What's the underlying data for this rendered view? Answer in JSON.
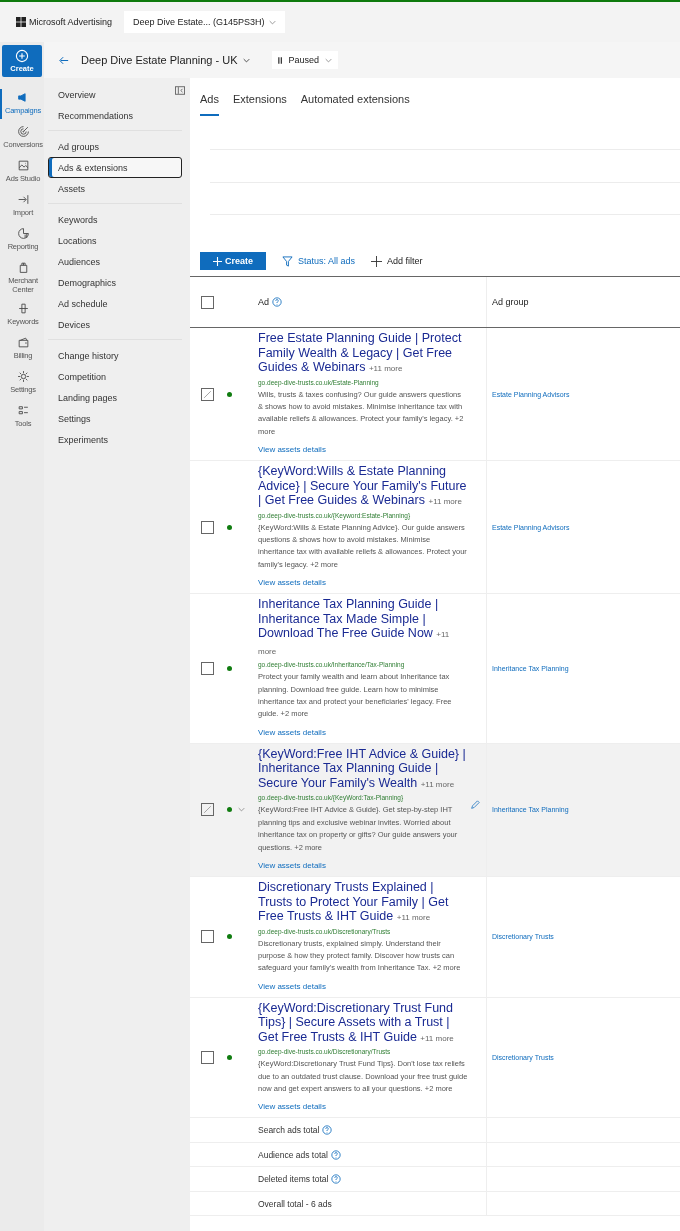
{
  "app": {
    "brand": "Microsoft Advertising",
    "account": "Deep Dive Estate... (G145PS3H)"
  },
  "rail": {
    "create": "Create",
    "items": [
      {
        "label": "Campaigns",
        "selected": true
      },
      {
        "label": "Conversions",
        "selected": false
      },
      {
        "label": "Ads Studio",
        "selected": false
      },
      {
        "label": "Import",
        "selected": false
      },
      {
        "label": "Reporting",
        "selected": false
      },
      {
        "label": "Merchant Center",
        "selected": false
      },
      {
        "label": "Keywords",
        "selected": false
      },
      {
        "label": "Billing",
        "selected": false
      },
      {
        "label": "Settings",
        "selected": false
      },
      {
        "label": "Tools",
        "selected": false
      }
    ]
  },
  "campaign": {
    "name": "Deep Dive Estate Planning - UK",
    "status": "Paused"
  },
  "nav": {
    "groups": [
      [
        {
          "label": "Overview",
          "selected": false
        },
        {
          "label": "Recommendations",
          "selected": false
        }
      ],
      [
        {
          "label": "Ad groups",
          "selected": false
        },
        {
          "label": "Ads & extensions",
          "selected": true
        },
        {
          "label": "Assets",
          "selected": false
        }
      ],
      [
        {
          "label": "Keywords",
          "selected": false
        },
        {
          "label": "Locations",
          "selected": false
        },
        {
          "label": "Audiences",
          "selected": false
        },
        {
          "label": "Demographics",
          "selected": false
        },
        {
          "label": "Ad schedule",
          "selected": false
        },
        {
          "label": "Devices",
          "selected": false
        }
      ],
      [
        {
          "label": "Change history",
          "selected": false
        },
        {
          "label": "Competition",
          "selected": false
        },
        {
          "label": "Landing pages",
          "selected": false
        },
        {
          "label": "Settings",
          "selected": false
        },
        {
          "label": "Experiments",
          "selected": false
        }
      ]
    ]
  },
  "tabs": [
    {
      "label": "Ads",
      "selected": true
    },
    {
      "label": "Extensions",
      "selected": false
    },
    {
      "label": "Automated extensions",
      "selected": false
    }
  ],
  "toolbar": {
    "create": "Create",
    "status_filter": "Status: All ads",
    "add_filter": "Add filter"
  },
  "table": {
    "columns": [
      "Ad",
      "Ad group"
    ],
    "select_all_checked": false,
    "rows": [
      {
        "title": "Free Estate Planning Guide | Protect Family Wealth & Legacy | Get Free Guides & Webinars",
        "more": "+11 more",
        "url": "go.deep-dive-trusts.co.uk/Estate-Planning",
        "description": "Wills, trusts & taxes confusing? Our guide answers questions & shows how to avoid mistakes. Minimise inheritance tax with available reliefs & allowances. Protect your family's legacy. +2 more",
        "link": "View assets details",
        "ad_group": "Estate Planning Advisors",
        "color": "#107c10",
        "tick_shown": true,
        "hovered": false
      },
      {
        "title": "{KeyWord:Wills & Estate Planning Advice} | Secure Your Family's Future | Get Free Guides & Webinars",
        "more": "+11 more",
        "url": "go.deep-dive-trusts.co.uk/{Keyword:Estate-Planning}",
        "description": "{KeyWord:Wills & Estate Planning Advice}. Our guide answers questions & shows how to avoid mistakes. Minimise inheritance tax with available reliefs & allowances. Protect your family's legacy. +2 more",
        "link": "View assets details",
        "ad_group": "Estate Planning Advisors",
        "color": "#107c10",
        "tick_shown": false,
        "hovered": false
      },
      {
        "title": "Inheritance Tax Planning Guide | Inheritance Tax Made Simple | Download The Free Guide Now",
        "more": "+11 more",
        "url": "go.deep-dive-trusts.co.uk/Inheritance/Tax-Planning",
        "description": "Protect your family wealth and learn about Inheritance tax planning. Download free guide. Learn how to minimise inheritance tax and protect your beneficiaries' legacy. Free guide. +2 more",
        "link": "View assets details",
        "ad_group": "Inheritance Tax Planning",
        "color": "#107c10",
        "tick_shown": false,
        "hovered": false
      },
      {
        "title": "{KeyWord:Free IHT Advice & Guide} | Inheritance Tax Planning Guide | Secure Your Family's Wealth",
        "more": "+11 more",
        "url": "go.deep-dive-trusts.co.uk/{KeyWord:Tax-Planning}",
        "description": "{KeyWord:Free IHT Advice & Guide}. Get step-by-step IHT planning tips and exclusive webinar invites. Worried about inheritance tax on property or gifts? Our guide answers your questions. +2 more",
        "link": "View assets details",
        "ad_group": "Inheritance Tax Planning",
        "color": "#107c10",
        "tick_shown": true,
        "hovered": true
      },
      {
        "title": "Discretionary Trusts Explained | Trusts to Protect Your Family | Get Free Trusts & IHT Guide",
        "more": "+11 more",
        "url": "go.deep-dive-trusts.co.uk/Discretionary/Trusts",
        "description": "Discretionary trusts, explained simply. Understand their purpose & how they protect family. Discover how trusts can safeguard your family's wealth from Inheritance Tax. +2 more",
        "link": "View assets details",
        "ad_group": "Discretionary Trusts",
        "color": "#107c10",
        "tick_shown": false,
        "hovered": false
      },
      {
        "title": "{KeyWord:Discretionary Trust Fund Tips} | Secure Assets with a Trust | Get Free Trusts & IHT Guide",
        "more": "+11 more",
        "url": "go.deep-dive-trusts.co.uk/Discretionary/Trusts",
        "description": "{KeyWord:Discretionary Trust Fund Tips}. Don't lose tax reliefs due to an outdated trust clause. Download your free trust guide now and get expert answers to all your questions. +2 more",
        "link": "View assets details",
        "ad_group": "Discretionary Trusts",
        "color": "#107c10",
        "tick_shown": false,
        "hovered": false
      }
    ],
    "totals": [
      {
        "label": "Search ads total",
        "help": true
      },
      {
        "label": "Audience ads total",
        "help": true
      },
      {
        "label": "Deleted items total",
        "help": true
      },
      {
        "label": "Overall total - 6 ads",
        "help": false
      }
    ]
  }
}
